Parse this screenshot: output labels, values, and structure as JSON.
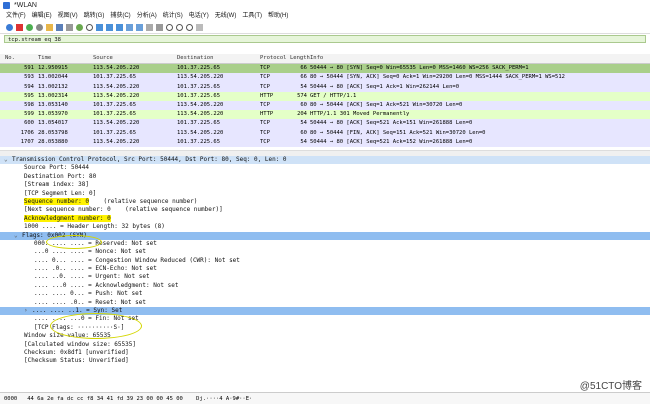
{
  "window": {
    "title": "*WLAN"
  },
  "menu": [
    "文件(F)",
    "编辑(E)",
    "视图(V)",
    "跳转(G)",
    "捕获(C)",
    "分析(A)",
    "统计(S)",
    "电话(Y)",
    "无线(W)",
    "工具(T)",
    "帮助(H)"
  ],
  "filter": {
    "value": "tcp.stream eq 38"
  },
  "packet_list": {
    "headers": {
      "no": "No.",
      "time": "Time",
      "src": "Source",
      "dst": "Destination",
      "proto": "Protocol",
      "len": "Length",
      "info": "Info"
    },
    "rows": [
      {
        "no": "591",
        "time": "12.950915",
        "src": "113.54.205.220",
        "dst": "101.37.225.65",
        "proto": "TCP",
        "len": "66",
        "info": "50444 → 80 [SYN] Seq=0 Win=65535 Len=0 MSS=1460 WS=256 SACK_PERM=1"
      },
      {
        "no": "593",
        "time": "13.002044",
        "src": "101.37.225.65",
        "dst": "113.54.205.220",
        "proto": "TCP",
        "len": "66",
        "info": "80 → 50444 [SYN, ACK] Seq=0 Ack=1 Win=29200 Len=0 MSS=1444 SACK_PERM=1 WS=512"
      },
      {
        "no": "594",
        "time": "13.002132",
        "src": "113.54.205.220",
        "dst": "101.37.225.65",
        "proto": "TCP",
        "len": "54",
        "info": "50444 → 80 [ACK] Seq=1 Ack=1 Win=262144 Len=0"
      },
      {
        "no": "595",
        "time": "13.002314",
        "src": "113.54.205.220",
        "dst": "101.37.225.65",
        "proto": "HTTP",
        "len": "574",
        "info": "GET / HTTP/1.1"
      },
      {
        "no": "598",
        "time": "13.053140",
        "src": "101.37.225.65",
        "dst": "113.54.205.220",
        "proto": "TCP",
        "len": "60",
        "info": "80 → 50444 [ACK] Seq=1 Ack=521 Win=30720 Len=0"
      },
      {
        "no": "599",
        "time": "13.053970",
        "src": "101.37.225.65",
        "dst": "113.54.205.220",
        "proto": "HTTP",
        "len": "204",
        "info": "HTTP/1.1 301 Moved Permanently"
      },
      {
        "no": "600",
        "time": "13.054017",
        "src": "113.54.205.220",
        "dst": "101.37.225.65",
        "proto": "TCP",
        "len": "54",
        "info": "50444 → 80 [ACK] Seq=521 Ack=151 Win=261888 Len=0"
      },
      {
        "no": "1706",
        "time": "28.053798",
        "src": "101.37.225.65",
        "dst": "113.54.205.220",
        "proto": "TCP",
        "len": "60",
        "info": "80 → 50444 [FIN, ACK] Seq=151 Ack=521 Win=30720 Len=0"
      },
      {
        "no": "1707",
        "time": "28.053880",
        "src": "113.54.205.220",
        "dst": "101.37.225.65",
        "proto": "TCP",
        "len": "54",
        "info": "50444 → 80 [ACK] Seq=521 Ack=152 Win=261888 Len=0"
      }
    ]
  },
  "details": {
    "l0": "Transmission Control Protocol, Src Port: 50444, Dst Port: 80, Seq: 0, Len: 0",
    "l1": "Source Port: 50444",
    "l2": "Destination Port: 80",
    "l3": "[Stream index: 38]",
    "l4": "[TCP Segment Len: 0]",
    "l5a": "Sequence number: 0",
    "l5b": "(relative sequence number)",
    "l6a": "[Next sequence number: 0",
    "l6b": "(relative sequence number)]",
    "l7": "Acknowledgment number: 0",
    "l8": "1000 .... = Header Length: 32 bytes (8)",
    "l9": "Flags: 0x002 (SYN)",
    "l10": "000. .... .... = Reserved: Not set",
    "l11": "...0 .... .... = Nonce: Not set",
    "l12": ".... 0... .... = Congestion Window Reduced (CWR): Not set",
    "l13": ".... .0.. .... = ECN-Echo: Not set",
    "l14": ".... ..0. .... = Urgent: Not set",
    "l15": ".... ...0 .... = Acknowledgment: Not set",
    "l16": ".... .... 0... = Push: Not set",
    "l17": ".... .... .0.. = Reset: Not set",
    "l18": ".... .... ..1. = Syn: Set",
    "l19": ".... .... ...0 = Fin: Not set",
    "l20": "[TCP Flags: ··········S·]",
    "l21": "Window size value: 65535",
    "l22": "[Calculated window size: 65535]",
    "l23": "Checksum: 0x8df1 [unverified]",
    "l24": "[Checksum Status: Unverified]"
  },
  "bytes": {
    "offset": "0000",
    "hex": "44 6a 2e fa dc cc f8 34  41 fd 39 23 00 00 45 00",
    "ascii": "Dj.····4 A·9#··E·"
  },
  "watermark": "@51CTO博客"
}
